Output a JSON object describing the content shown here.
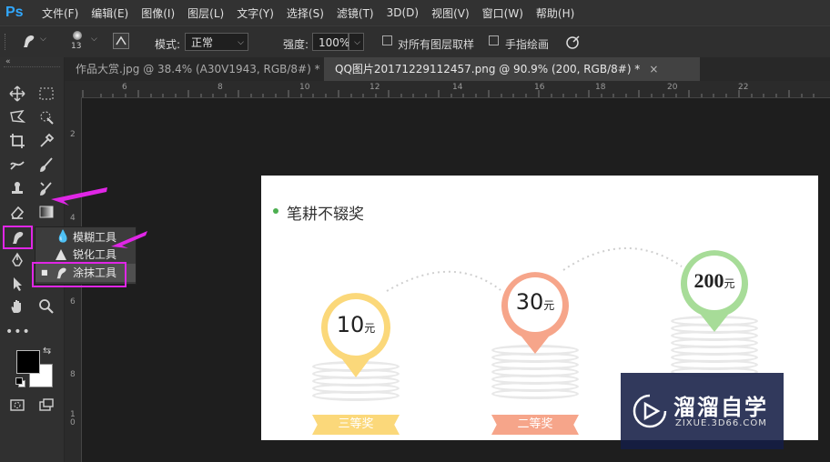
{
  "app": {
    "logo": "Ps"
  },
  "menu": [
    "文件(F)",
    "编辑(E)",
    "图像(I)",
    "图层(L)",
    "文字(Y)",
    "选择(S)",
    "滤镜(T)",
    "3D(D)",
    "视图(V)",
    "窗口(W)",
    "帮助(H)"
  ],
  "options": {
    "brush_size": "13",
    "mode_label": "模式:",
    "mode_value": "正常",
    "strength_label": "强度:",
    "strength_value": "100%",
    "sample_all_layers": "对所有图层取样",
    "finger_painting": "手指绘画"
  },
  "tabs": [
    {
      "label": "作品大赏.jpg @ 38.4% (A30V1943, RGB/8#) *",
      "close": "×",
      "active": false
    },
    {
      "label": "QQ图片20171229112457.png @ 90.9% (200, RGB/8#) *",
      "close": "×",
      "active": true
    }
  ],
  "ruler_top": [
    "6",
    "8",
    "10",
    "12",
    "14",
    "16",
    "18",
    "20",
    "22"
  ],
  "ruler_left": [
    "2",
    "4",
    "6",
    "8",
    "1\n0"
  ],
  "flyout": {
    "items": [
      "模糊工具",
      "锐化工具",
      "涂抹工具"
    ],
    "selected_index": 2
  },
  "document": {
    "heading": "笔耕不辍奖",
    "bullet_color": "#4caf50",
    "prizes": [
      {
        "amount": "10",
        "unit": "元",
        "ribbon": "三等奖",
        "color": "#fbd87a"
      },
      {
        "amount": "30",
        "unit": "元",
        "ribbon": "二等奖",
        "color": "#f6a58a"
      },
      {
        "amount": "200",
        "unit": "元",
        "ribbon": "",
        "color": "#a7dc98"
      }
    ]
  },
  "watermark": {
    "title": "溜溜自学",
    "url": "ZIXUE.3D66.COM"
  },
  "colors": {
    "accent": "#e026e6",
    "ps_blue": "#31a8ff"
  }
}
